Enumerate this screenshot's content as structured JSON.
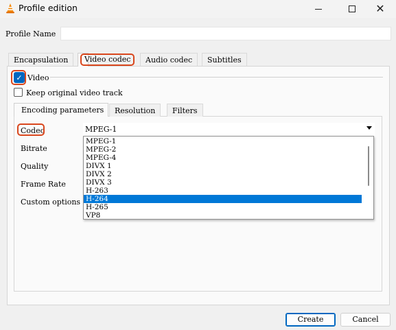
{
  "window": {
    "title": "Profile edition",
    "icon": "vlc-cone-icon"
  },
  "profile": {
    "name_label": "Profile Name",
    "name_value": ""
  },
  "tabs": [
    {
      "label": "Encapsulation"
    },
    {
      "label": "Video codec",
      "active": true
    },
    {
      "label": "Audio codec"
    },
    {
      "label": "Subtitles"
    }
  ],
  "video": {
    "enabled_label": "Video",
    "enabled": true,
    "keep_original_label": "Keep original video track",
    "keep_original": false
  },
  "inner_tabs": [
    {
      "label": "Encoding parameters",
      "active": true
    },
    {
      "label": "Resolution"
    },
    {
      "label": "Filters"
    }
  ],
  "encoding": {
    "codec_label": "Codec",
    "codec_value": "MPEG-1",
    "bitrate_label": "Bitrate",
    "quality_label": "Quality",
    "frame_rate_label": "Frame Rate",
    "custom_options_label": "Custom options"
  },
  "codec_options": [
    {
      "label": "MPEG-1"
    },
    {
      "label": "MPEG-2"
    },
    {
      "label": "MPEG-4"
    },
    {
      "label": "DIVX 1"
    },
    {
      "label": "DIVX 2"
    },
    {
      "label": "DIVX 3"
    },
    {
      "label": "H-263"
    },
    {
      "label": "H-264",
      "highlighted": true
    },
    {
      "label": "H-265"
    },
    {
      "label": "VP8"
    }
  ],
  "buttons": {
    "create": "Create",
    "cancel": "Cancel"
  },
  "colors": {
    "accent": "#0067c0",
    "highlight": "#0078d7",
    "annotation_ring": "#d9461c"
  }
}
